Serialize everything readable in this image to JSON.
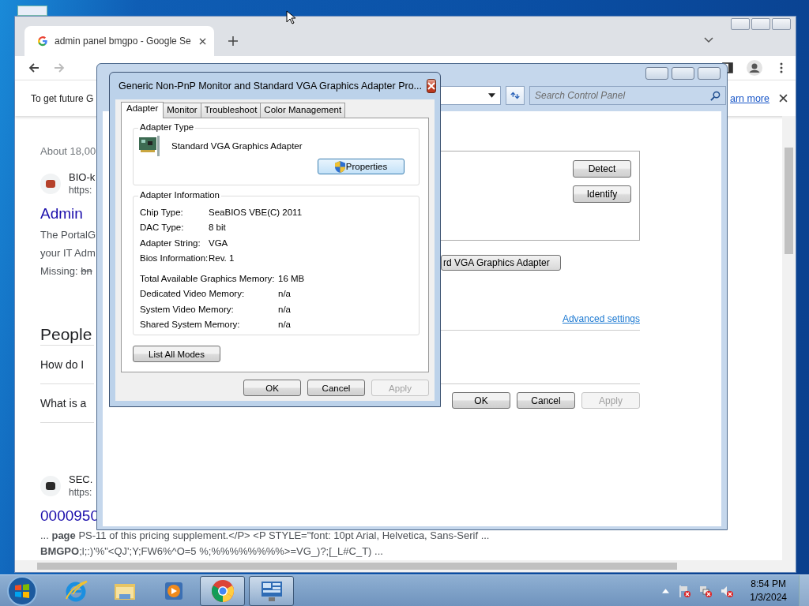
{
  "browser": {
    "tab_title": "admin panel bmgpo - Google Se",
    "infobar": {
      "text": "To get future G",
      "link": "arn more"
    },
    "results": [
      {
        "kind": "count",
        "text": "About 18,00"
      },
      {
        "kind": "site",
        "name": "BIO-k",
        "url": "https:",
        "color": "#b5412a"
      },
      {
        "kind": "title",
        "text": "Admin"
      },
      {
        "kind": "text",
        "text": "The PortalG"
      },
      {
        "kind": "text",
        "text": "your IT Adm"
      },
      {
        "kind": "missing",
        "text": "Missing:",
        "struck": "bn"
      },
      {
        "kind": "heading",
        "text": "People"
      },
      {
        "kind": "question",
        "text": "How do I"
      },
      {
        "kind": "question",
        "text": "What is a"
      },
      {
        "kind": "site",
        "name": "SEC.",
        "url": "https:",
        "color": "#2a2a2a"
      },
      {
        "kind": "title",
        "text": "0000950"
      },
      {
        "kind": "snippet",
        "text": "... **page** PS-11 of this pricing supplement.</P> <P STYLE=\"font: 10pt Arial, Helvetica, Sans-Serif ..."
      },
      {
        "kind": "snippet",
        "text": "**BMGPO**;l;:)'%\"<QJ';Y;FW6%^O=5 %;%%%%%%%%>=VG_)?;[_L#C_T) ..."
      }
    ]
  },
  "control_panel": {
    "search": {
      "placeholder": "Search Control Panel"
    },
    "buttons_side": [
      "Detect",
      "Identify"
    ],
    "adapter_dropdown": "rd VGA Graphics Adapter",
    "link": "Advanced settings",
    "buttons": [
      {
        "label": "OK",
        "disabled": false
      },
      {
        "label": "Cancel",
        "disabled": false
      },
      {
        "label": "Apply",
        "disabled": true
      }
    ]
  },
  "dialog": {
    "title": "Generic Non-PnP Monitor and Standard VGA Graphics Adapter Pro...",
    "tabs": [
      {
        "label": "Adapter",
        "selected": true
      },
      {
        "label": "Monitor",
        "selected": false
      },
      {
        "label": "Troubleshoot",
        "selected": false
      },
      {
        "label": "Color Management",
        "selected": false
      }
    ],
    "adapter_type": {
      "legend": "Adapter Type",
      "name": "Standard VGA Graphics Adapter",
      "button": "Properties"
    },
    "adapter_info": {
      "legend": "Adapter Information",
      "rows": [
        {
          "label": "Chip Type:",
          "value": "SeaBIOS VBE(C) 2011"
        },
        {
          "label": "DAC Type:",
          "value": "8 bit"
        },
        {
          "label": "Adapter String:",
          "value": "VGA"
        },
        {
          "label": "Bios Information:",
          "value": "Rev. 1"
        }
      ],
      "memory_rows": [
        {
          "label": "Total Available Graphics Memory:",
          "value": "16 MB"
        },
        {
          "label": "Dedicated Video Memory:",
          "value": "n/a"
        },
        {
          "label": "System Video Memory:",
          "value": "n/a"
        },
        {
          "label": "Shared System Memory:",
          "value": "n/a"
        }
      ]
    },
    "list_button": "List All Modes",
    "buttons": [
      {
        "label": "OK",
        "disabled": false
      },
      {
        "label": "Cancel",
        "disabled": false
      },
      {
        "label": "Apply",
        "disabled": true
      }
    ]
  },
  "taskbar": {
    "items": [
      {
        "kind": "ie",
        "running": false
      },
      {
        "kind": "folder",
        "running": false
      },
      {
        "kind": "media",
        "running": false
      },
      {
        "kind": "chrome",
        "running": true
      },
      {
        "kind": "control-panel",
        "running": true
      }
    ],
    "time": "8:54 PM",
    "date": "1/3/2024"
  }
}
